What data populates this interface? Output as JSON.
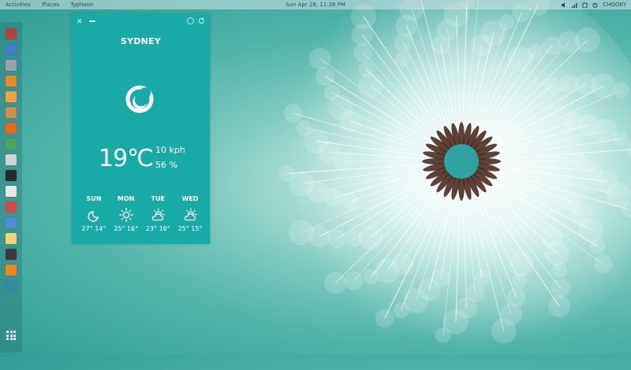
{
  "topbar": {
    "activities": "Activities",
    "places": "Places",
    "app": "Typhoon",
    "clock": "Sun Apr 28, 11:38 PM",
    "user": "CHOOKY"
  },
  "dock": {
    "items": [
      {
        "icon": "terminal-red-icon",
        "color": "#b2453a"
      },
      {
        "icon": "document-icon",
        "color": "#3f7fc4"
      },
      {
        "icon": "drive-icon",
        "color": "#9aa3a8"
      },
      {
        "icon": "settings-icon",
        "color": "#e38b2a"
      },
      {
        "icon": "settings-gear-icon",
        "color": "#f0a23c"
      },
      {
        "icon": "package-icon",
        "color": "#d18c4a"
      },
      {
        "icon": "firefox-icon",
        "color": "#e26c1c"
      },
      {
        "icon": "chrome-icon",
        "color": "#4aa55e"
      },
      {
        "icon": "calculator-icon",
        "color": "#cfd4d6"
      },
      {
        "icon": "console-icon",
        "color": "#2b2b2b"
      },
      {
        "icon": "calendar-icon",
        "color": "#e8e8e8"
      },
      {
        "icon": "mail-icon",
        "color": "#d94848"
      },
      {
        "icon": "photos-icon",
        "color": "#4b8fd6"
      },
      {
        "icon": "notes-icon",
        "color": "#f3d27a"
      },
      {
        "icon": "music-icon",
        "color": "#3b3b3b"
      },
      {
        "icon": "vlc-icon",
        "color": "#f0871d"
      },
      {
        "icon": "app-icon",
        "color": "#2c8fa3"
      }
    ]
  },
  "weather": {
    "city": "SYDNEY",
    "temperature": "19℃",
    "wind": "10 kph",
    "humidity": "56 %",
    "current_icon": "moon-icon",
    "forecast": [
      {
        "day": "SUN",
        "icon": "moon-icon",
        "temps": "27° 14°"
      },
      {
        "day": "MON",
        "icon": "sun-icon",
        "temps": "25° 16°"
      },
      {
        "day": "TUE",
        "icon": "partly-cloudy-icon",
        "temps": "23° 16°"
      },
      {
        "day": "WED",
        "icon": "partly-cloudy-icon",
        "temps": "25° 15°"
      }
    ]
  },
  "colors": {
    "widget_bg": "#19aaa5",
    "text": "#ffffff"
  }
}
